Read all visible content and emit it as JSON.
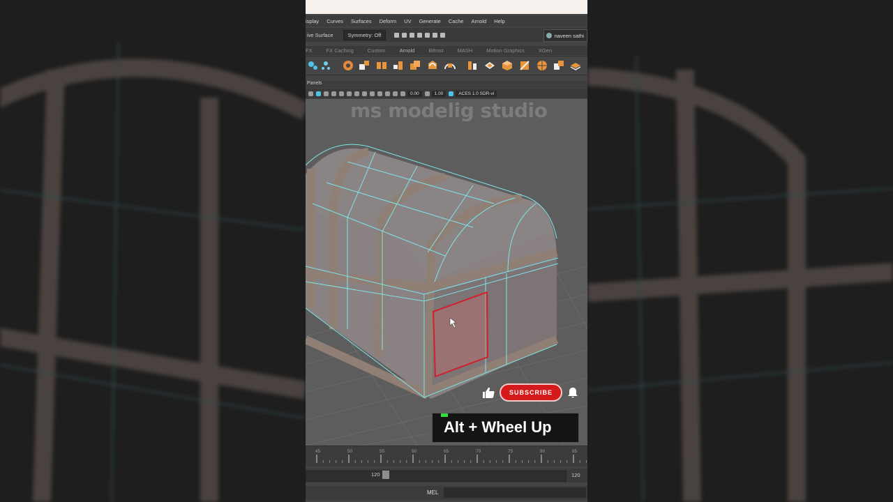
{
  "menu": [
    "isplay",
    "Curves",
    "Surfaces",
    "Deform",
    "UV",
    "Generate",
    "Cache",
    "Arnold",
    "Help"
  ],
  "status": {
    "live_surface": "ive Surface",
    "symmetry": "Symmetry: Off",
    "user": "naveen sathi"
  },
  "shelf_tabs": [
    "FX",
    "FX Caching",
    "Custom",
    "Arnold",
    "Bifrost",
    "MASH",
    "Motion Graphics",
    "XGen"
  ],
  "active_shelf_tab": "Arnold",
  "panels_label": "Panels",
  "view_toolbar": {
    "exposure": "0.00",
    "gamma": "1.00",
    "color_space": "ACES 1.0 SDR-vi"
  },
  "watermark": "ms modelig studio",
  "subscribe": {
    "label": "SUBSCRIBE",
    "like_icon": "thumbs-up-icon",
    "bell_icon": "bell-icon",
    "brand_color": "#d41a1a"
  },
  "caption": "Alt + Wheel Up",
  "timeline": {
    "ticks": [
      "45",
      "50",
      "55",
      "60",
      "65",
      "70",
      "75",
      "80",
      "85"
    ]
  },
  "range": {
    "start": "120",
    "end": "120"
  },
  "command_line": {
    "language": "MEL"
  },
  "colors": {
    "wireframe": "#7ee4ea",
    "selection": "#d21f2f",
    "chest_body": "#8b8382",
    "chest_band": "#8f7f74"
  }
}
